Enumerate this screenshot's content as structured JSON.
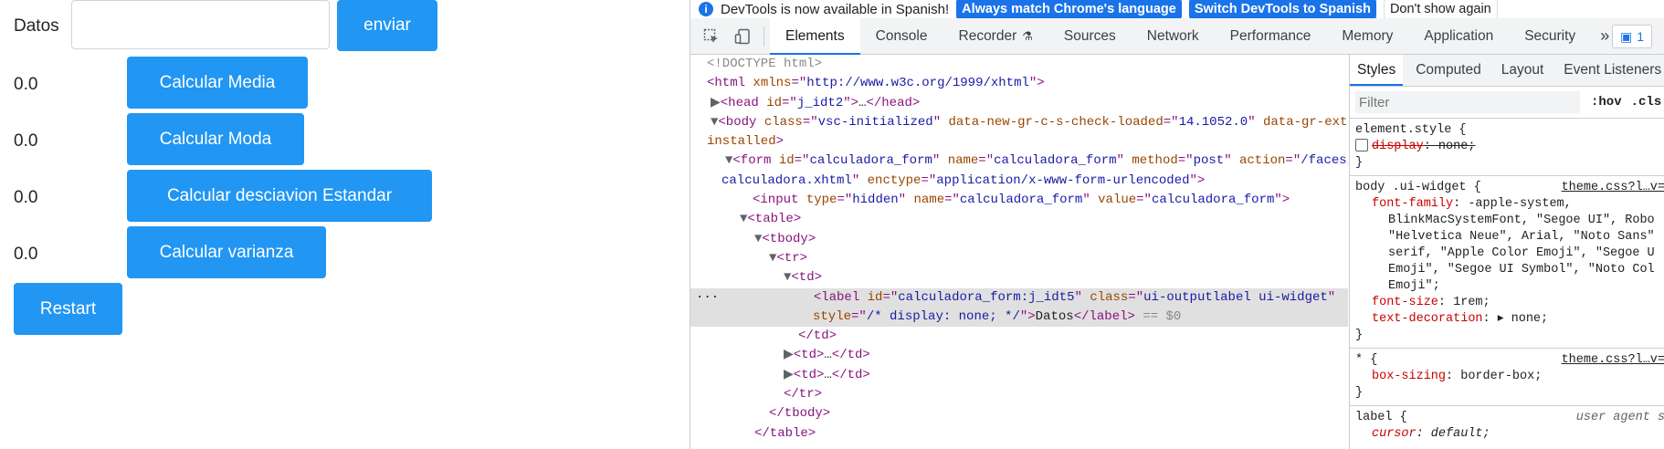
{
  "app": {
    "datos_label": "Datos",
    "datos_value": "",
    "enviar_label": "enviar",
    "rows": [
      {
        "value": "0.0",
        "button": "Calcular Media"
      },
      {
        "value": "0.0",
        "button": "Calcular Moda"
      },
      {
        "value": "0.0",
        "button": "Calcular desciavion Estandar"
      },
      {
        "value": "0.0",
        "button": "Calcular varianza"
      }
    ],
    "restart_label": "Restart"
  },
  "devtools": {
    "infobar": {
      "message": "DevTools is now available in Spanish!",
      "btn_match": "Always match Chrome's language",
      "btn_switch": "Switch DevTools to Spanish",
      "btn_dismiss": "Don't show again"
    },
    "tabs": [
      "Elements",
      "Console",
      "Recorder",
      "Sources",
      "Network",
      "Performance",
      "Memory",
      "Application",
      "Security"
    ],
    "more_tabs": "»",
    "issues_count": "1",
    "side_tabs": [
      "Styles",
      "Computed",
      "Layout",
      "Event Listeners"
    ],
    "filter_placeholder": "Filter",
    "hov": ":hov",
    "cls": ".cls",
    "colors": {
      "accent": "#1a73e8",
      "app_button": "#2196f3"
    }
  }
}
